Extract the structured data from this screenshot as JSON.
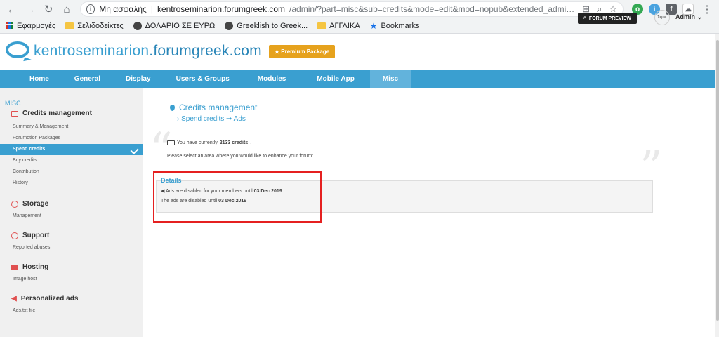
{
  "browser": {
    "security_label": "Μη ασφαλής",
    "url_host": "kentroseminarion.forumgreek.com",
    "url_path": "/admin/?part=misc&sub=credits&mode=edit&mod=nopub&extended_admin=1&tid=5324...",
    "bookmarks": [
      {
        "label": "Εφαρμογές",
        "icon": "apps-icon"
      },
      {
        "label": "Σελιδοδείκτες",
        "icon": "folder-icon"
      },
      {
        "label": "ΔΟΛΑΡΙΟ ΣΕ ΕΥΡΩ",
        "icon": "globe-icon"
      },
      {
        "label": "Greeklish to Greek...",
        "icon": "globe-icon"
      },
      {
        "label": "ΑΓΓΛΙΚΑ",
        "icon": "folder-icon"
      },
      {
        "label": "Bookmarks",
        "icon": "star-icon"
      }
    ]
  },
  "header": {
    "site_name_part1": "kentroseminarion",
    "site_name_part2": ".forumgreek.com",
    "premium_label": "Premium Package",
    "preview_label": "FORUM PREVIEW",
    "admin_label": "Admin",
    "avatar_text": "Σεμιν."
  },
  "nav": {
    "items": [
      "Home",
      "General",
      "Display",
      "Users & Groups",
      "Modules",
      "Mobile App",
      "Misc"
    ],
    "active": "Misc"
  },
  "sidebar": {
    "root": "MISC",
    "sections": [
      {
        "title": "Credits management",
        "links": [
          "Summary & Management",
          "Forumotion Packages",
          "Spend credits",
          "Buy credits",
          "Contribution",
          "History"
        ]
      },
      {
        "title": "Storage",
        "links": [
          "Management"
        ]
      },
      {
        "title": "Support",
        "links": [
          "Reported abuses"
        ]
      },
      {
        "title": "Hosting",
        "links": [
          "Image host"
        ]
      },
      {
        "title": "Personalized ads",
        "links": [
          "Ads.txt file"
        ]
      }
    ],
    "active_link": "Spend credits"
  },
  "main": {
    "title": "Credits management",
    "breadcrumb_a": "Spend credits",
    "breadcrumb_b": "Ads",
    "credits_prefix": "You have currently ",
    "credits_value": "2133 credits",
    "credits_suffix": ".",
    "prompt": "Please select an area where you would like to enhance your forum:",
    "details_title": "Details",
    "details_line1_prefix": "Ads are disabled for your members until ",
    "details_line1_date": "03 Dec 2019",
    "details_line1_suffix": ".",
    "details_line2_prefix": "The ads are disabled until ",
    "details_line2_date": "03 Dec 2019"
  },
  "colors": {
    "accent": "#3a9fd0",
    "premium": "#e6a21d",
    "highlight": "#e52020"
  }
}
